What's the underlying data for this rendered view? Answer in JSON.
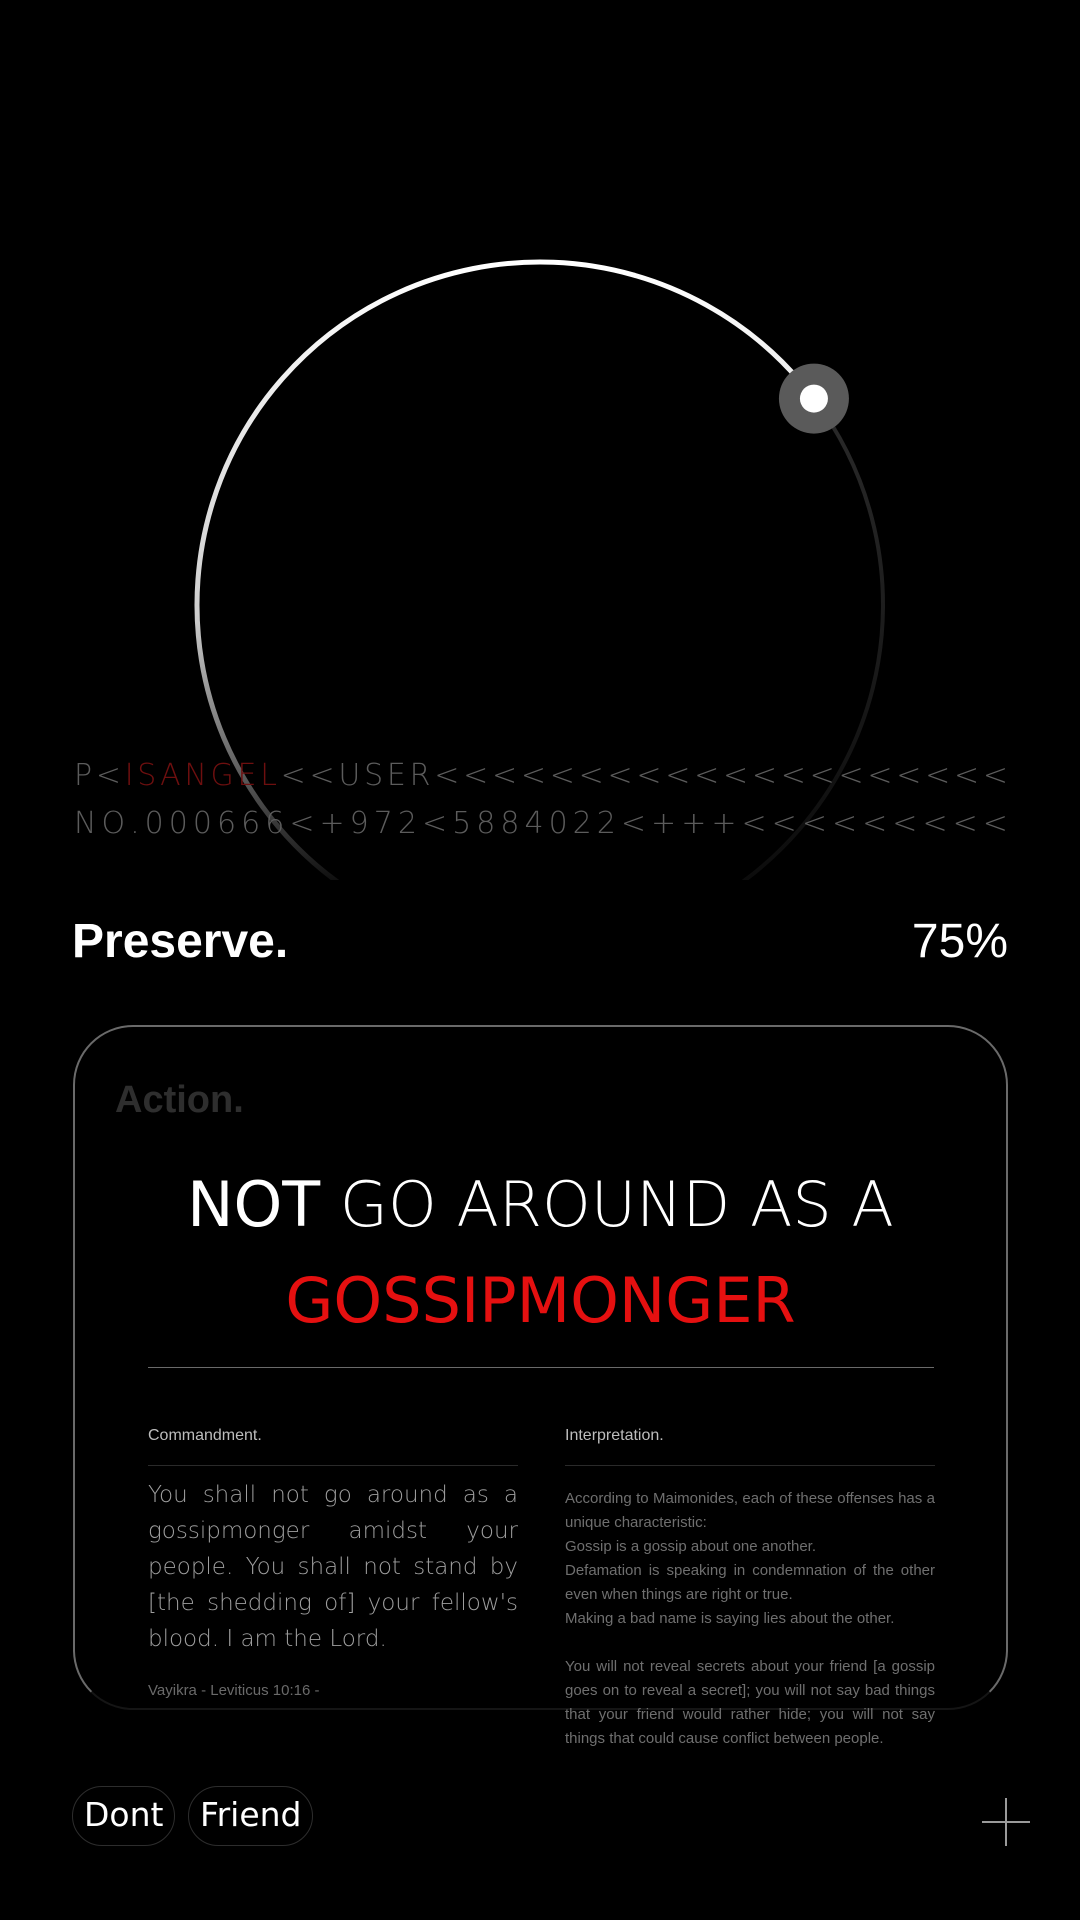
{
  "mrz": {
    "line1": [
      "P",
      "<",
      "I",
      "S",
      "A",
      "N",
      "G",
      "E",
      "L",
      "<",
      "<",
      "U",
      "S",
      "E",
      "R",
      "<",
      "<",
      "<",
      "<",
      "<",
      "<",
      "<",
      "<",
      "<",
      "<",
      "<",
      "<",
      "<",
      "<",
      "<",
      "<",
      "<",
      "<",
      "<",
      "<"
    ],
    "line1_red_range": [
      2,
      8
    ],
    "line2": [
      "N",
      "O",
      ".",
      "0",
      "0",
      "0",
      "6",
      "6",
      "6",
      "<",
      "+",
      "9",
      "7",
      "2",
      "<",
      "5",
      "8",
      "8",
      "4",
      "0",
      "2",
      "2",
      "<",
      "+",
      "+",
      "+",
      "<",
      "<",
      "<",
      "<",
      "<",
      "<",
      "<",
      "<",
      "<"
    ]
  },
  "status": {
    "label": "Preserve.",
    "value": "75%",
    "fraction": 0.75
  },
  "card": {
    "label": "Action.",
    "headline_strong": "NOT",
    "headline_light": "GO AROUND AS A",
    "headline_red": "GOSSIPMONGER",
    "commandment_title": "Commandment.",
    "commandment_text": "You shall not go around as a gossipmonger amidst your people. You shall not stand by [the shedding of] your fellow's blood. I am the Lord.",
    "source": "Vayikra - Leviticus 10:16  -",
    "interpretation_title": "Interpretation.",
    "interpretation": [
      "According to Maimonides, each of these offenses has a unique characteristic:",
      "Gossip is a gossip about one another.",
      "Defamation is speaking in condemnation of the other even when things are right or true.",
      "Making a bad name is saying lies about the other.",
      "",
      "You will not reveal secrets about your friend [a gossip goes on to reveal a secret]; you will not say bad things that your friend would rather hide; you will not say things that could cause conflict between people."
    ]
  },
  "chips": [
    "Dont",
    "Friend"
  ],
  "icons": {
    "add": "plus-icon"
  },
  "colors": {
    "accent": "#e51010",
    "background": "#000000"
  }
}
